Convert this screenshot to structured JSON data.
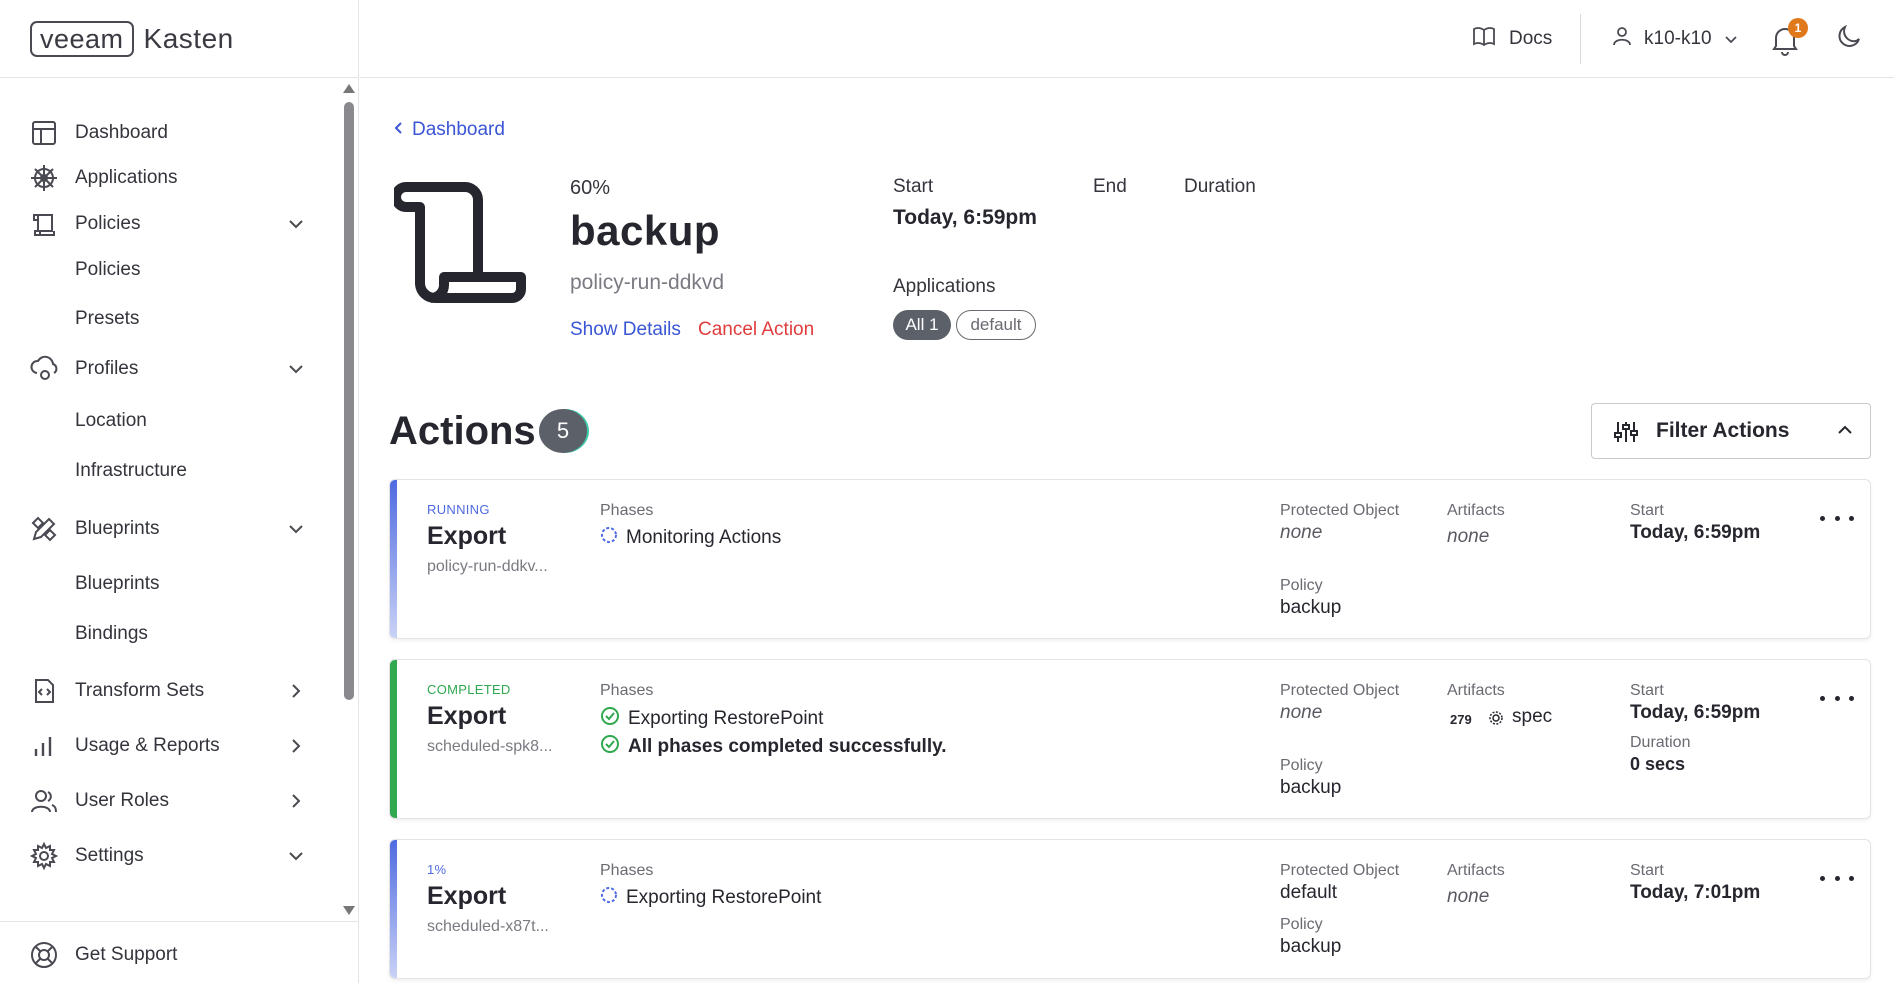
{
  "brand": {
    "logo_box": "veeam",
    "logo_text": "Kasten"
  },
  "sidebar": {
    "items": [
      {
        "label": "Dashboard"
      },
      {
        "label": "Applications"
      },
      {
        "label": "Policies"
      },
      {
        "label": "Policies"
      },
      {
        "label": "Presets"
      },
      {
        "label": "Profiles"
      },
      {
        "label": "Location"
      },
      {
        "label": "Infrastructure"
      },
      {
        "label": "Blueprints"
      },
      {
        "label": "Blueprints"
      },
      {
        "label": "Bindings"
      },
      {
        "label": "Transform Sets"
      },
      {
        "label": "Usage & Reports"
      },
      {
        "label": "User Roles"
      },
      {
        "label": "Settings"
      }
    ],
    "support_label": "Get Support"
  },
  "topbar": {
    "docs_label": "Docs",
    "user_label": "k10-k10",
    "notification_count": "1"
  },
  "run": {
    "breadcrumb": "Dashboard",
    "progress": "60%",
    "name": "backup",
    "id": "policy-run-ddkvd",
    "show_details": "Show Details",
    "cancel_action": "Cancel Action",
    "start_label": "Start",
    "start_value": "Today, 6:59pm",
    "end_label": "End",
    "duration_label": "Duration",
    "applications_label": "Applications",
    "chip_all": "All 1",
    "chip_default": "default"
  },
  "actions": {
    "title": "Actions",
    "count": "5",
    "filter_label": "Filter Actions",
    "labels": {
      "phases": "Phases",
      "protected_object": "Protected Object",
      "artifacts": "Artifacts",
      "policy": "Policy",
      "start": "Start",
      "duration": "Duration"
    },
    "cards": [
      {
        "status": "RUNNING",
        "title": "Export",
        "subtitle": "policy-run-ddkv...",
        "phase1": "Monitoring Actions",
        "protected_object": "none",
        "artifacts": "none",
        "policy": "backup",
        "start": "Today, 6:59pm",
        "accent": "#4f6ae0"
      },
      {
        "status": "COMPLETED",
        "title": "Export",
        "subtitle": "scheduled-spk8...",
        "phase1": "Exporting RestorePoint",
        "phase2": "All phases completed successfully.",
        "protected_object": "none",
        "artifacts_count": "279",
        "artifacts_name": "spec",
        "policy": "backup",
        "start": "Today, 6:59pm",
        "duration": "0 secs",
        "accent": "#2fa84f"
      },
      {
        "status": "1%",
        "title": "Export",
        "subtitle": "scheduled-x87t...",
        "phase1": "Exporting RestorePoint",
        "protected_object": "default",
        "artifacts": "none",
        "policy": "backup",
        "start": "Today, 7:01pm",
        "accent": "#4f6ae0"
      }
    ]
  }
}
